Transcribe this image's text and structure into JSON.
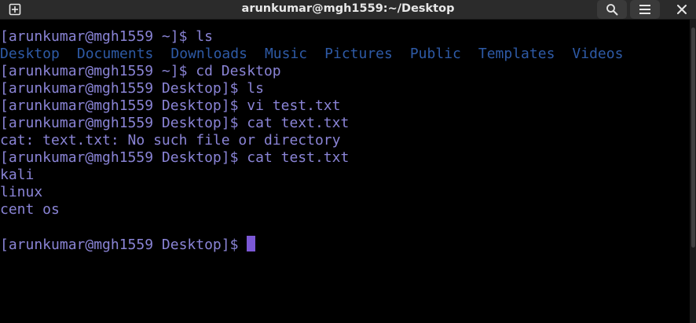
{
  "window": {
    "title": "arunkumar@mgh1559:~/Desktop",
    "icons": {
      "new_tab": "new-tab-icon",
      "search": "search-icon",
      "menu": "hamburger-menu-icon",
      "close": "close-icon"
    }
  },
  "colors": {
    "background": "#000000",
    "prompt_text": "#8a84d6",
    "directory": "#2e5aa6",
    "cursor": "#7b58d6",
    "headerbar": "#2b2b2b"
  },
  "terminal": {
    "lines": [
      {
        "type": "text",
        "text": "[arunkumar@mgh1559 ~]$ ls"
      },
      {
        "type": "ls",
        "items": [
          "Desktop",
          "Documents",
          "Downloads",
          "Music",
          "Pictures",
          "Public",
          "Templates",
          "Videos"
        ]
      },
      {
        "type": "text",
        "text": "[arunkumar@mgh1559 ~]$ cd Desktop"
      },
      {
        "type": "text",
        "text": "[arunkumar@mgh1559 Desktop]$ ls"
      },
      {
        "type": "text",
        "text": "[arunkumar@mgh1559 Desktop]$ vi test.txt"
      },
      {
        "type": "text",
        "text": "[arunkumar@mgh1559 Desktop]$ cat text.txt"
      },
      {
        "type": "text",
        "text": "cat: text.txt: No such file or directory"
      },
      {
        "type": "text",
        "text": "[arunkumar@mgh1559 Desktop]$ cat test.txt"
      },
      {
        "type": "text",
        "text": "kali"
      },
      {
        "type": "text",
        "text": "linux"
      },
      {
        "type": "text",
        "text": "cent os"
      },
      {
        "type": "text",
        "text": ""
      },
      {
        "type": "prompt",
        "text": "[arunkumar@mgh1559 Desktop]$ "
      }
    ]
  }
}
